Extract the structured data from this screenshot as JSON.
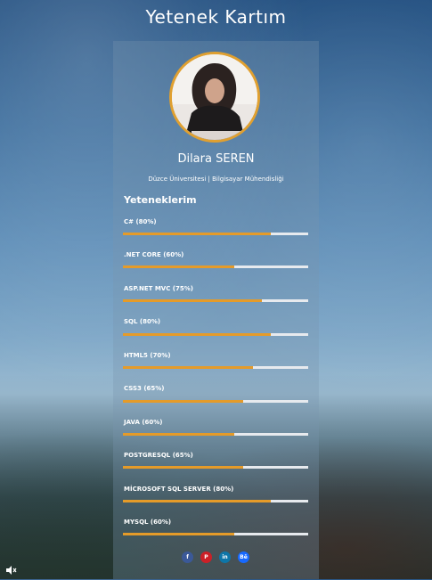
{
  "page": {
    "title": "Yetenek Kartım"
  },
  "profile": {
    "name": "Dilara SEREN",
    "subtitle": "Düzce Üniversitesi | Bilgisayar Mühendisliği"
  },
  "skills": {
    "heading": "Yeteneklerim",
    "items": [
      {
        "label": "C# (80%)",
        "value": 0.8
      },
      {
        "label": ".NET CORE (60%)",
        "value": 0.6
      },
      {
        "label": "ASP.NET MVC (75%)",
        "value": 0.75
      },
      {
        "label": "SQL (80%)",
        "value": 0.8
      },
      {
        "label": "HTML5 (70%)",
        "value": 0.7
      },
      {
        "label": "CSS3 (65%)",
        "value": 0.65
      },
      {
        "label": "JAVA (60%)",
        "value": 0.6
      },
      {
        "label": "POSTGRESQL (65%)",
        "value": 0.65
      },
      {
        "label": "MİCROSOFT SQL SERVER (80%)",
        "value": 0.8
      },
      {
        "label": "MYSQL (60%)",
        "value": 0.6
      }
    ]
  },
  "social": {
    "facebook": {
      "glyph": "f",
      "color": "#3b5998"
    },
    "pinterest": {
      "glyph": "P",
      "color": "#cb2027"
    },
    "linkedin": {
      "glyph": "in",
      "color": "#0e76a8"
    },
    "behance": {
      "glyph": "Bē",
      "color": "#1769ff"
    }
  },
  "colors": {
    "accent": "#e59b29",
    "track": "#e7eaee"
  }
}
